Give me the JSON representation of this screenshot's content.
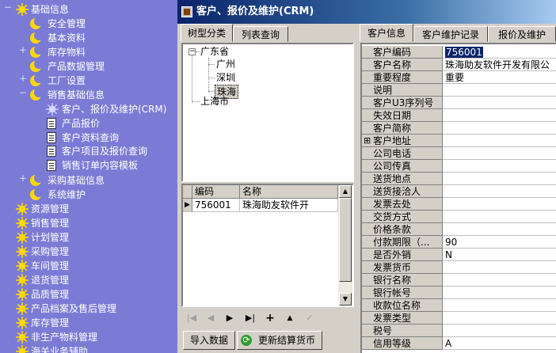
{
  "nav": {
    "items": [
      {
        "label": "基础信息",
        "expander": "－",
        "icon": "sun-icon",
        "level": 0
      },
      {
        "label": "安全管理",
        "icon": "moon-icon",
        "level": 1
      },
      {
        "label": "基本资料",
        "icon": "moon-icon",
        "level": 1
      },
      {
        "label": "库存物料",
        "expander": "＋",
        "icon": "moon-icon",
        "level": 1
      },
      {
        "label": "产品数据管理",
        "icon": "moon-icon",
        "level": 1
      },
      {
        "label": "工厂设置",
        "expander": "＋",
        "icon": "moon-icon",
        "level": 1
      },
      {
        "label": "销售基础信息",
        "expander": "－",
        "icon": "moon-icon",
        "level": 1
      },
      {
        "label": "客户、报价及维护(CRM)",
        "icon": "sun-outline-icon",
        "level": 2
      },
      {
        "label": "产品报价",
        "icon": "document-icon",
        "level": 2
      },
      {
        "label": "客户资料查询",
        "icon": "document-icon",
        "level": 2
      },
      {
        "label": "客户项目及报价查询",
        "icon": "document-icon",
        "level": 2
      },
      {
        "label": "销售订单内容模板",
        "icon": "document-icon",
        "level": 2
      },
      {
        "label": "采购基础信息",
        "expander": "＋",
        "icon": "moon-icon",
        "level": 1
      },
      {
        "label": "系统维护",
        "icon": "moon-icon",
        "level": 1
      },
      {
        "label": "资源管理",
        "icon": "sun-icon",
        "level": 0
      },
      {
        "label": "销售管理",
        "icon": "sun-icon",
        "level": 0
      },
      {
        "label": "计划管理",
        "icon": "sun-icon",
        "level": 0
      },
      {
        "label": "采购管理",
        "icon": "sun-icon",
        "level": 0
      },
      {
        "label": "车间管理",
        "icon": "sun-icon",
        "level": 0
      },
      {
        "label": "退货管理",
        "icon": "sun-icon",
        "level": 0
      },
      {
        "label": "品质管理",
        "icon": "sun-icon",
        "level": 0
      },
      {
        "label": "产品档案及售后管理",
        "icon": "sun-icon",
        "level": 0
      },
      {
        "label": "库存管理",
        "icon": "sun-icon",
        "level": 0
      },
      {
        "label": "非生产物料管理",
        "icon": "sun-icon",
        "level": 0
      },
      {
        "label": "海关业务辅助",
        "icon": "sun-icon",
        "level": 0
      }
    ]
  },
  "window": {
    "title": "客户、报价及维护(CRM)"
  },
  "left_tabs": [
    "树型分类",
    "列表查询"
  ],
  "right_tabs": [
    "客户信息",
    "客户维护记录",
    "报价及维护"
  ],
  "region_tree": {
    "root": "广东省",
    "children": [
      "广州",
      "深圳",
      "珠海"
    ],
    "selected": "珠海",
    "other_root": "上海市"
  },
  "customer_grid": {
    "columns": [
      "编码",
      "名称"
    ],
    "rows": [
      {
        "code": "756001",
        "name": "珠海助友软件开"
      }
    ]
  },
  "buttons": {
    "import_data": "导入数据",
    "update_currency": "更新结算货币"
  },
  "properties": [
    {
      "label": "客户编码",
      "value": "756001",
      "selected": true
    },
    {
      "label": "客户名称",
      "value": "珠海助友软件开发有限公"
    },
    {
      "label": "重要程度",
      "value": "重要"
    },
    {
      "label": "说明",
      "value": ""
    },
    {
      "label": "客户U3序列号",
      "value": ""
    },
    {
      "label": "失效日期",
      "value": ""
    },
    {
      "label": "客户简称",
      "value": ""
    },
    {
      "label": "客户地址",
      "value": "",
      "expander": "⊞"
    },
    {
      "label": "公司电话",
      "value": ""
    },
    {
      "label": "公司传真",
      "value": ""
    },
    {
      "label": "送货地点",
      "value": ""
    },
    {
      "label": "送货接洽人",
      "value": ""
    },
    {
      "label": "发票去处",
      "value": ""
    },
    {
      "label": "交货方式",
      "value": ""
    },
    {
      "label": "价格条款",
      "value": ""
    },
    {
      "label": "付款期限（...",
      "value": "90"
    },
    {
      "label": "是否外销",
      "value": "N"
    },
    {
      "label": "发票货币",
      "value": ""
    },
    {
      "label": "银行名称",
      "value": ""
    },
    {
      "label": "银行帐号",
      "value": ""
    },
    {
      "label": "收款位名称",
      "value": ""
    },
    {
      "label": "发票类型",
      "value": ""
    },
    {
      "label": "税号",
      "value": ""
    },
    {
      "label": "信用等级",
      "value": "A"
    }
  ],
  "colors": {
    "nav_bg": "#7b7bd6",
    "title_start": "#0a246a",
    "title_end": "#a6caf0",
    "selection": "#0a246a",
    "face": "#d4d0c8"
  }
}
